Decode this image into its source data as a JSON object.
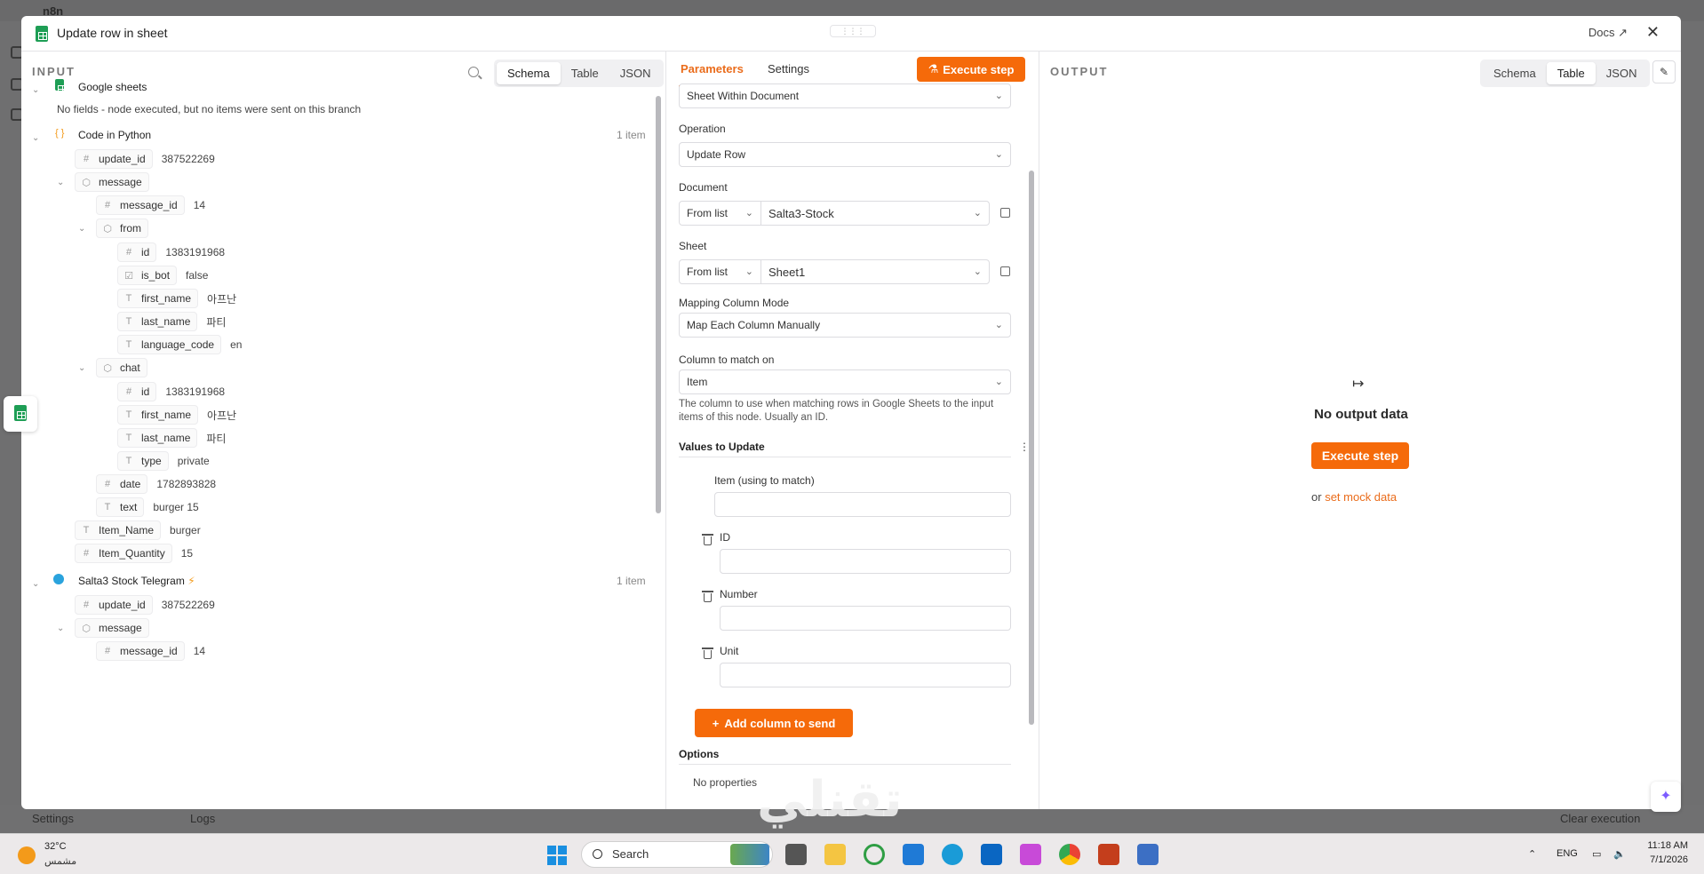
{
  "modal": {
    "title": "Update row in sheet",
    "docs": "Docs",
    "close": "✕"
  },
  "input": {
    "label": "INPUT",
    "tabs": [
      "Schema",
      "Table",
      "JSON"
    ],
    "active_tab": "Schema",
    "nodes": {
      "google_sheets": {
        "title": "Google sheets",
        "message": "No fields - node executed, but no items were sent on this branch"
      },
      "code_python": {
        "title": "Code in Python",
        "count": "1 item"
      },
      "telegram": {
        "title": "Salta3 Stock Telegram",
        "count": "1 item"
      }
    },
    "rows": [
      {
        "key": "update_id",
        "value": "387522269"
      },
      {
        "key": "message",
        "value": ""
      },
      {
        "key": "message_id",
        "value": "14"
      },
      {
        "key": "from",
        "value": ""
      },
      {
        "key": "id",
        "value": "1383191968"
      },
      {
        "key": "is_bot",
        "value": "false"
      },
      {
        "key": "first_name",
        "value": "아프난"
      },
      {
        "key": "last_name",
        "value": "파티"
      },
      {
        "key": "language_code",
        "value": "en"
      },
      {
        "key": "chat",
        "value": ""
      },
      {
        "key": "id",
        "value": "1383191968"
      },
      {
        "key": "first_name",
        "value": "아프난"
      },
      {
        "key": "last_name",
        "value": "파티"
      },
      {
        "key": "type",
        "value": "private"
      },
      {
        "key": "date",
        "value": "1782893828"
      },
      {
        "key": "text",
        "value": "burger 15"
      },
      {
        "key": "Item_Name",
        "value": "burger"
      },
      {
        "key": "Item_Quantity",
        "value": "15"
      },
      {
        "key": "update_id",
        "value": "387522269"
      },
      {
        "key": "message",
        "value": ""
      },
      {
        "key": "message_id",
        "value": "14"
      }
    ]
  },
  "params": {
    "tabs": [
      "Parameters",
      "Settings"
    ],
    "execute": "Execute step",
    "sheet_within": "Sheet Within Document",
    "operation_label": "Operation",
    "operation_value": "Update Row",
    "document_label": "Document",
    "document_mode": "From list",
    "document_value": "Salta3-Stock",
    "sheet_label": "Sheet",
    "sheet_mode": "From list",
    "sheet_value": "Sheet1",
    "mapping_label": "Mapping Column Mode",
    "mapping_value": "Map Each Column Manually",
    "match_label": "Column to match on",
    "match_value": "Item",
    "match_help": "The column to use when matching rows in Google Sheets to the input items of this node. Usually an ID.",
    "values_label": "Values to Update",
    "fields": [
      "Item (using to match)",
      "ID",
      "Number",
      "Unit"
    ],
    "add_column": "Add column to send",
    "options_label": "Options",
    "no_properties": "No properties"
  },
  "output": {
    "label": "OUTPUT",
    "tabs": [
      "Schema",
      "Table",
      "JSON"
    ],
    "active_tab": "Table",
    "empty": "No output data",
    "execute": "Execute step",
    "or": "or",
    "mock": "set mock data"
  },
  "background": {
    "logo": "n8n",
    "settings": "Settings",
    "logs": "Logs",
    "clear": "Clear execution"
  },
  "watermark": "تقنلي",
  "taskbar": {
    "temp": "32°C",
    "weather": "مشمس",
    "search": "Search",
    "lang": "ENG",
    "time": "11:18 AM",
    "date": "7/1/2026"
  }
}
